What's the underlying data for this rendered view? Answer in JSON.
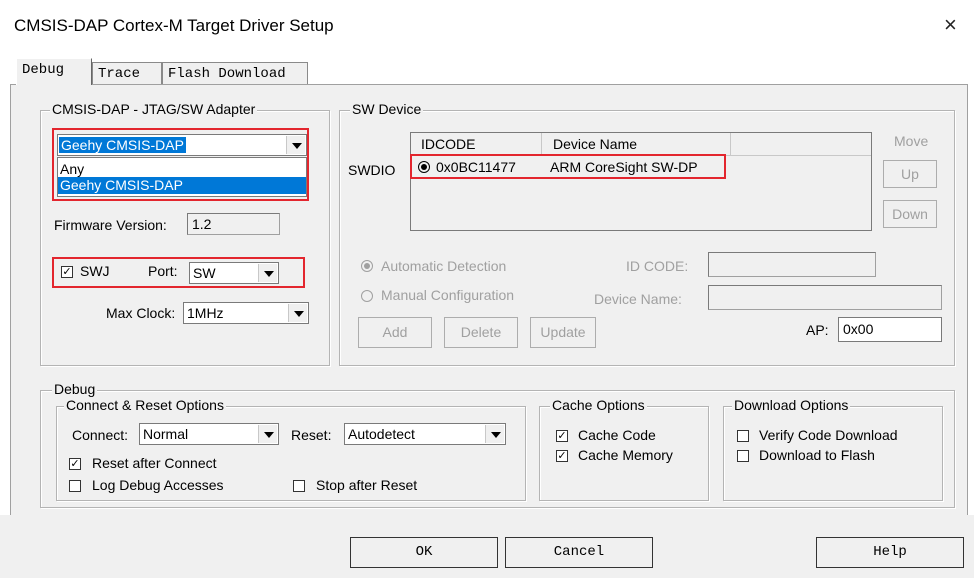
{
  "window": {
    "title": "CMSIS-DAP Cortex-M Target Driver Setup",
    "close_glyph": "×"
  },
  "tabs": [
    "Debug",
    "Trace",
    "Flash Download"
  ],
  "adapter": {
    "group_label": "CMSIS-DAP - JTAG/SW Adapter",
    "selected": "Geehy CMSIS-DAP",
    "options": [
      "Any",
      "Geehy CMSIS-DAP"
    ],
    "firmware_label": "Firmware Version:",
    "firmware_value": "1.2",
    "swj_label": "SWJ",
    "port_label": "Port:",
    "port_value": "SW",
    "maxclock_label": "Max Clock:",
    "maxclock_value": "1MHz"
  },
  "sw_device": {
    "group_label": "SW Device",
    "col_idcode": "IDCODE",
    "col_device": "Device Name",
    "row_label": "SWDIO",
    "row_idcode": "0x0BC11477",
    "row_device": "ARM CoreSight SW-DP",
    "move_label": "Move",
    "up_label": "Up",
    "down_label": "Down",
    "auto_detect": "Automatic Detection",
    "manual_config": "Manual Configuration",
    "idcode_label": "ID CODE:",
    "devname_label": "Device Name:",
    "add_label": "Add",
    "delete_label": "Delete",
    "update_label": "Update",
    "ap_label": "AP:",
    "ap_value": "0x00"
  },
  "debug": {
    "group_label": "Debug",
    "connect_group": "Connect & Reset Options",
    "connect_label": "Connect:",
    "connect_value": "Normal",
    "reset_label": "Reset:",
    "reset_value": "Autodetect",
    "reset_after_connect": "Reset after Connect",
    "log_debug": "Log Debug Accesses",
    "stop_after_reset": "Stop after Reset",
    "cache_group": "Cache Options",
    "cache_code": "Cache Code",
    "cache_memory": "Cache Memory",
    "download_group": "Download Options",
    "verify_download": "Verify Code Download",
    "download_flash": "Download to Flash"
  },
  "footer": {
    "ok": "OK",
    "cancel": "Cancel",
    "help": "Help"
  },
  "colors": {
    "highlight": "#0078d7",
    "annotation": "#e3262e",
    "dialog_bg": "#f0f0f0"
  }
}
